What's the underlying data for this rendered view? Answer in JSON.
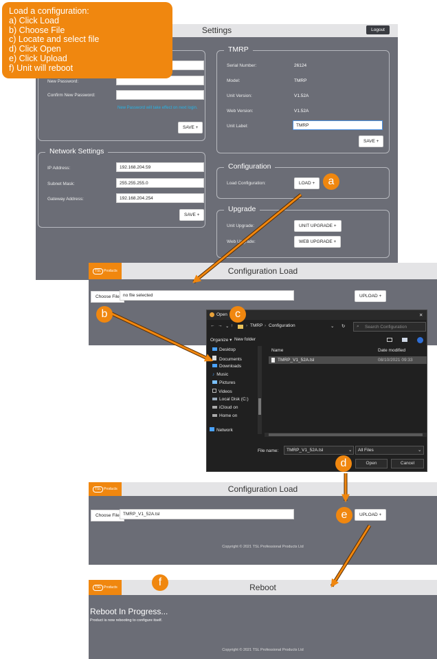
{
  "instructions": {
    "title": "Load a configuration:",
    "steps": [
      "a) Click Load",
      "b) Choose File",
      "c) Locate and select file",
      "d) Click Open",
      "e) Click Upload",
      "f) Unit will reboot"
    ]
  },
  "markers": {
    "a": "a",
    "b": "b",
    "c": "c",
    "d": "d",
    "e": "e",
    "f": "f"
  },
  "accent_color": "#f0870f",
  "settings": {
    "title": "Settings",
    "logout_label": "Logout",
    "password": {
      "new_password_label": "New Password:",
      "confirm_password_label": "Confirm New Password:",
      "hint": "New Password will take effect on next login.",
      "save_label": "SAVE +"
    },
    "network": {
      "legend": "Network Settings",
      "ip_label": "IP Address:",
      "ip_value": "192.168.204.59",
      "subnet_label": "Subnet Mask:",
      "subnet_value": "255.255.255.0",
      "gateway_label": "Gateway Address:",
      "gateway_value": "192.168.204.254",
      "save_label": "SAVE +"
    },
    "tmrp": {
      "legend": "TMRP",
      "serial_label": "Serial Number:",
      "serial_value": "26124",
      "model_label": "Model:",
      "model_value": "TMRP",
      "unit_version_label": "Unit Version:",
      "unit_version_value": "V1.52A",
      "web_version_label": "Web Version:",
      "web_version_value": "V1.52A",
      "unit_label_label": "Unit Label:",
      "unit_label_value": "TMRP",
      "save_label": "SAVE +"
    },
    "configuration": {
      "legend": "Configuration",
      "load_label": "Load Configuration:",
      "load_button": "LOAD +"
    },
    "upgrade": {
      "legend": "Upgrade",
      "unit_upgrade_label": "Unit Upgrade:",
      "unit_upgrade_button": "UNIT UPGRADE +",
      "web_upgrade_label": "Web Upgrade:",
      "web_upgrade_button": "WEB UPGRADE +"
    }
  },
  "config_load_1": {
    "logo_badge": "TSL",
    "logo_text": "Products",
    "title": "Configuration Load",
    "choose_file": "Choose File",
    "file_text": "no file selected",
    "upload": "UPLOAD +"
  },
  "open_dialog": {
    "title": "Open",
    "close": "✕",
    "path": [
      "TMRP",
      "Configuration"
    ],
    "search_placeholder": "Search Configuration",
    "organize": "Organize ▾",
    "new_folder": "New folder",
    "nav_items": [
      "Desktop",
      "Documents",
      "Downloads",
      "Music",
      "Pictures",
      "Videos",
      "Local Disk (C:)",
      "iCloud on",
      "Home on",
      "Network"
    ],
    "col_name": "Name",
    "col_date": "Date modified",
    "file_name": "TMRP_V1_52A.tsl",
    "file_date": "08/10/2021 09:33",
    "filename_label": "File name:",
    "filename_value": "TMRP_V1_52A.tsl",
    "filter": "All Files",
    "open_button": "Open",
    "cancel_button": "Cancel"
  },
  "config_load_2": {
    "logo_badge": "TSL",
    "logo_text": "Products",
    "title": "Configuration Load",
    "choose_file": "Choose File",
    "file_text": "TMRP_V1_52A.tsl",
    "upload": "UPLOAD +",
    "copyright": "Copyright © 2021 TSL Professional Products Ltd"
  },
  "reboot": {
    "logo_badge": "TSL",
    "logo_text": "Products",
    "title": "Reboot",
    "heading": "Reboot In Progress...",
    "message": "Product is now rebooting to configure itself.",
    "copyright": "Copyright © 2021 TSL Professional Products Ltd"
  }
}
